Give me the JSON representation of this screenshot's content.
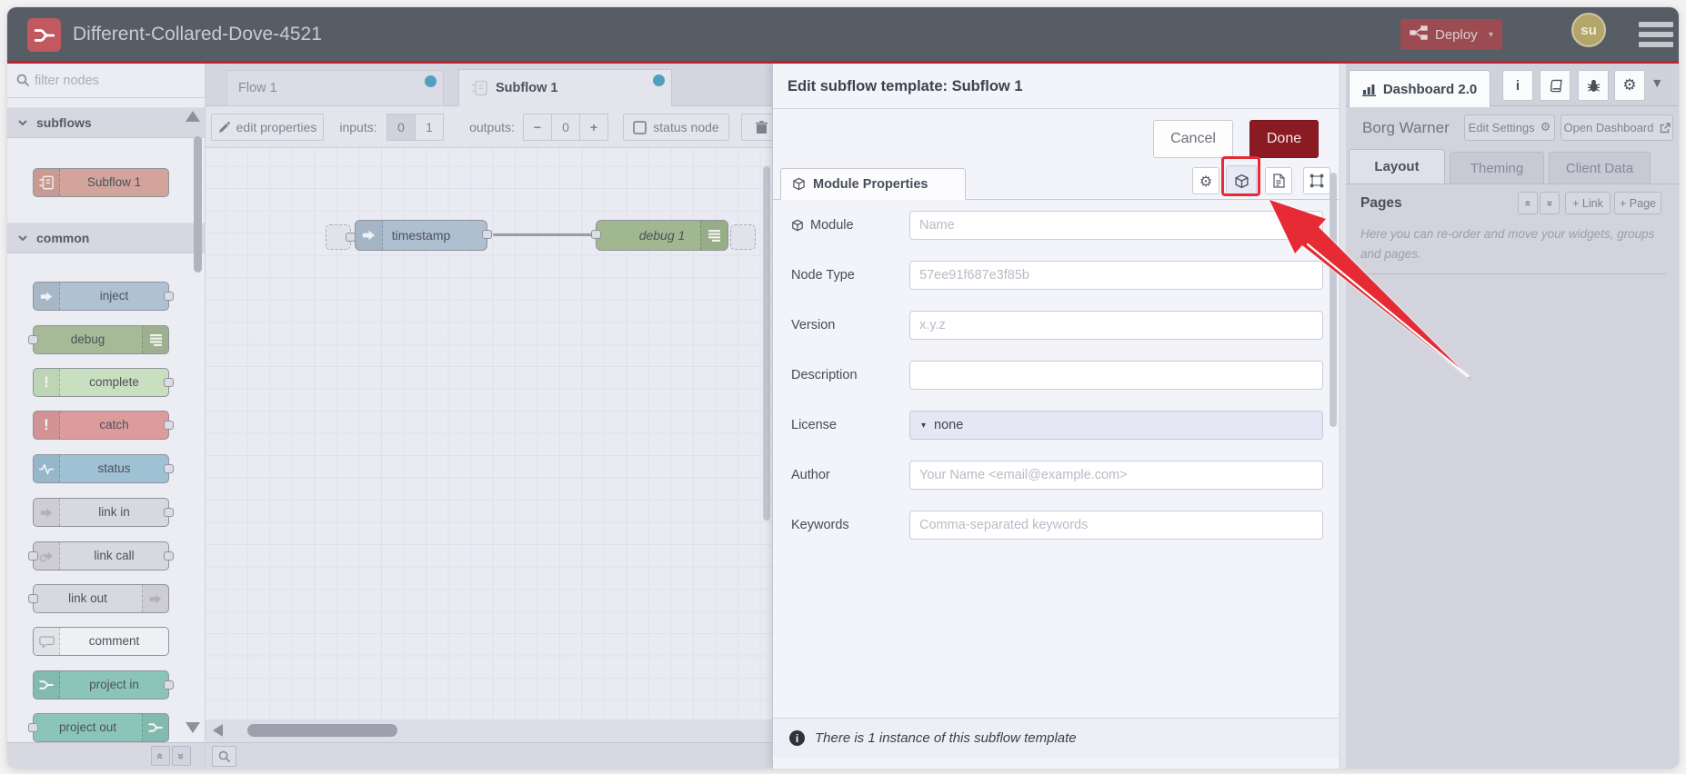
{
  "header": {
    "title": "Different-Collared-Dove-4521",
    "deploy_label": "Deploy",
    "avatar_initials": "su"
  },
  "palette": {
    "filter_placeholder": "filter nodes",
    "categories": [
      {
        "label": "subflows"
      },
      {
        "label": "common"
      }
    ],
    "nodes": {
      "subflow1": "Subflow 1",
      "inject": "inject",
      "debug": "debug",
      "complete": "complete",
      "catch": "catch",
      "status": "status",
      "link_in": "link in",
      "link_call": "link call",
      "link_out": "link out",
      "comment": "comment",
      "project_in": "project in",
      "project_out": "project out"
    }
  },
  "workspace": {
    "tabs": [
      {
        "label": "Flow 1"
      },
      {
        "label": "Subflow 1"
      }
    ],
    "toolbar": {
      "edit_properties": "edit properties",
      "inputs_label": "inputs:",
      "inputs_options": [
        "0",
        "1"
      ],
      "outputs_label": "outputs:",
      "outputs_minus": "−",
      "outputs_value": "0",
      "outputs_plus": "+",
      "status_node_label": "status node"
    },
    "nodes": {
      "timestamp": "timestamp",
      "debug1": "debug 1"
    }
  },
  "tray": {
    "title": "Edit subflow template: Subflow 1",
    "cancel_label": "Cancel",
    "done_label": "Done",
    "tab_label": "Module Properties",
    "fields": {
      "module": {
        "label": "Module",
        "placeholder": "Name"
      },
      "node_type": {
        "label": "Node Type",
        "placeholder": "57ee91f687e3f85b"
      },
      "version": {
        "label": "Version",
        "placeholder": "x.y.z"
      },
      "description": {
        "label": "Description",
        "placeholder": ""
      },
      "license": {
        "label": "License",
        "value": "none"
      },
      "author": {
        "label": "Author",
        "placeholder": "Your Name <email@example.com>"
      },
      "keywords": {
        "label": "Keywords",
        "placeholder": "Comma-separated keywords"
      }
    },
    "footer_text": "There is 1 instance of this subflow template"
  },
  "sidebar": {
    "active_tab": "Dashboard 2.0",
    "dashboard_name": "Borg Warner",
    "edit_settings_label": "Edit Settings",
    "open_dashboard_label": "Open Dashboard",
    "tabs": [
      "Layout",
      "Theming",
      "Client Data"
    ],
    "pages": {
      "title": "Pages",
      "add_link_label": "+ Link",
      "add_page_label": "+ Page",
      "help_text": "Here you can re-order and move your widgets, groups and pages."
    }
  },
  "colors": {
    "header_bg": "#575d65",
    "header_accent_line": "#c32031",
    "deploy_button": "#9c4b52",
    "done_button": "#8a1b22",
    "annotation_red": "#e62b35",
    "tab_dot": "#4f9fbe",
    "node_inject": "#b0c1d1",
    "node_debug": "#a6ba97",
    "node_complete": "#c8e0bf",
    "node_catch": "#dd9b9b",
    "node_status": "#9fc1d4",
    "node_link": "#d8d9df",
    "node_comment": "#eef0f4",
    "node_project": "#8bc5b8",
    "node_subflow": "#d2a49c"
  }
}
